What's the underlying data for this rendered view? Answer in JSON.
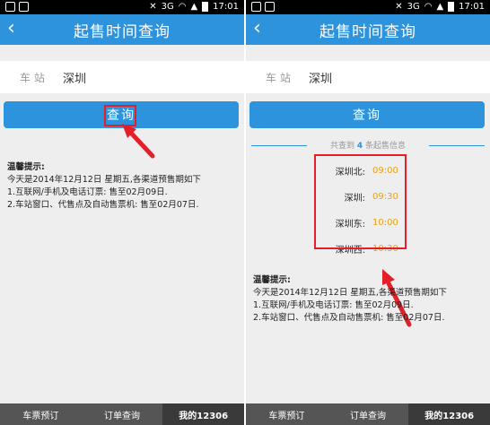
{
  "status": {
    "net": "3G",
    "time": "17:01"
  },
  "appbar": {
    "back": "‹",
    "title": "起售时间查询"
  },
  "station": {
    "label": "车站",
    "value": "深圳"
  },
  "query_button": "查询",
  "tips": {
    "heading": "温馨提示:",
    "line1": "今天是2014年12月12日 星期五,各渠道预售期如下",
    "line2": "1.互联网/手机及电话订票: 售至02月09日.",
    "line3": "2.车站窗口、代售点及自动售票机: 售至02月07日."
  },
  "results": {
    "count_prefix": "共查到",
    "count": "4",
    "count_suffix": "条起售信息",
    "items": [
      {
        "name": "深圳北:",
        "time": "09:00"
      },
      {
        "name": "深圳:",
        "time": "09:30"
      },
      {
        "name": "深圳东:",
        "time": "10:00"
      },
      {
        "name": "深圳西:",
        "time": "10:30"
      }
    ]
  },
  "nav": [
    "车票预订",
    "订单查询",
    "我的12306"
  ],
  "colors": {
    "brand": "#2d93dc",
    "highlight": "#e3202a",
    "time": "#e6a11d"
  }
}
